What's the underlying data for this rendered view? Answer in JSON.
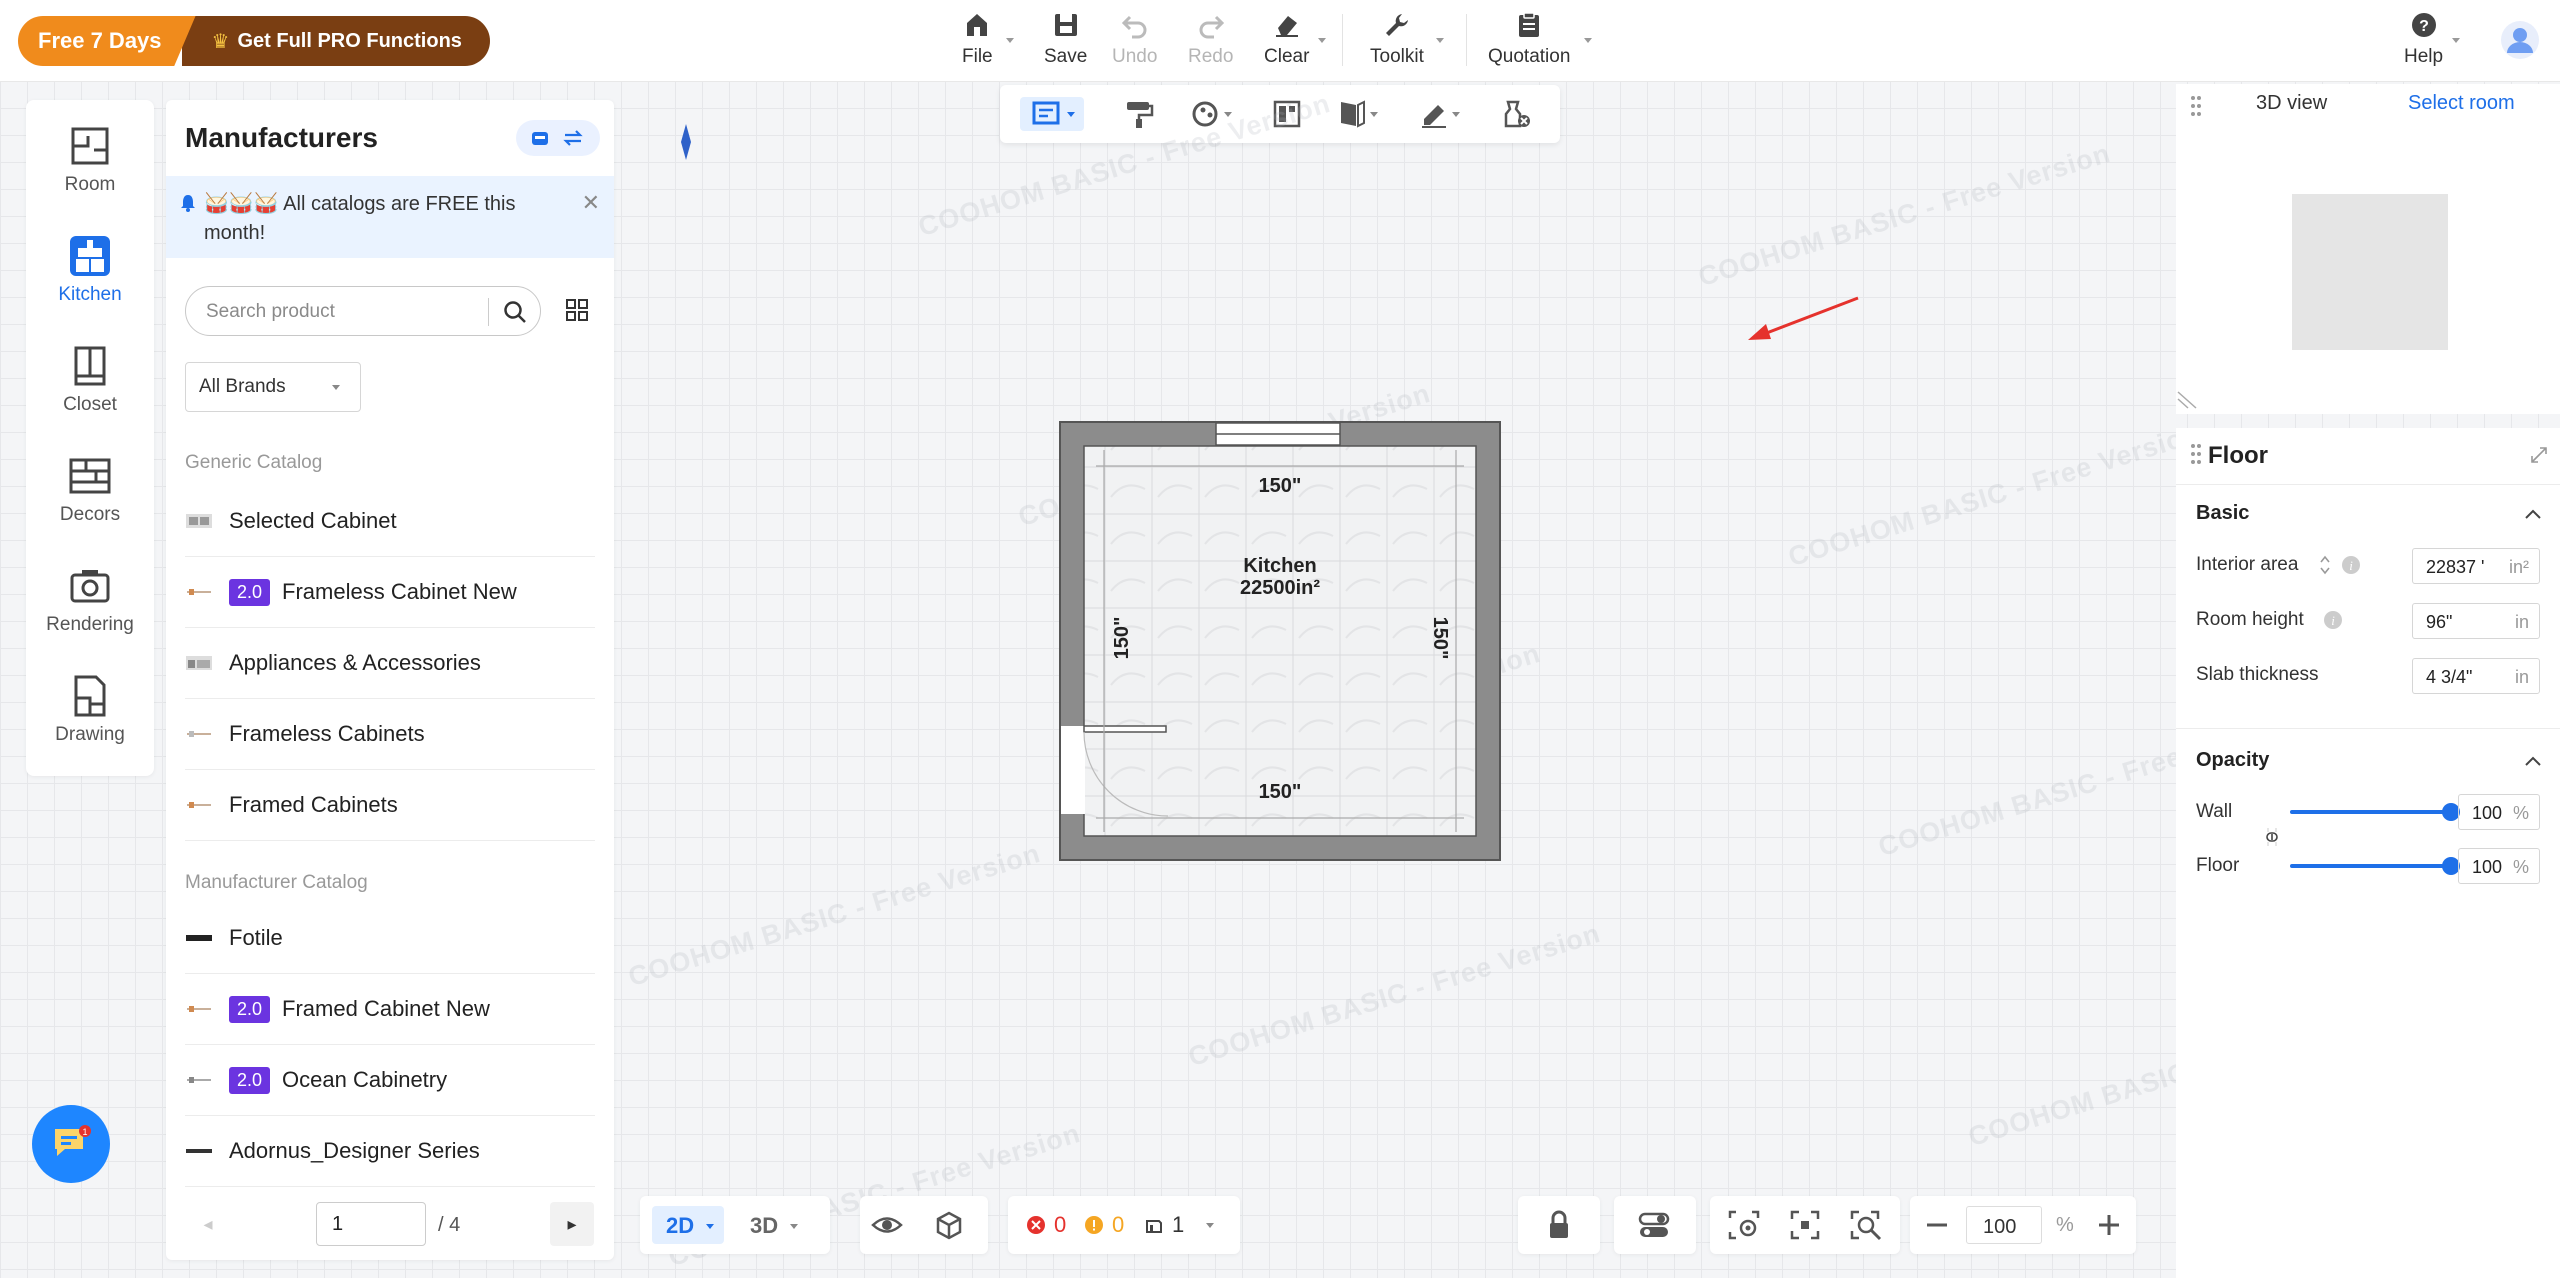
{
  "promo": {
    "free_label": "Free 7 Days",
    "pro_label": "Get Full PRO Functions"
  },
  "toolbar": {
    "file": "File",
    "save": "Save",
    "undo": "Undo",
    "redo": "Redo",
    "clear": "Clear",
    "toolkit": "Toolkit",
    "quotation": "Quotation",
    "help": "Help"
  },
  "leftnav": {
    "items": [
      {
        "label": "Room"
      },
      {
        "label": "Kitchen"
      },
      {
        "label": "Closet"
      },
      {
        "label": "Decors"
      },
      {
        "label": "Rendering"
      },
      {
        "label": "Drawing"
      }
    ]
  },
  "catalog": {
    "title": "Manufacturers",
    "notice": "🥁🥁🥁 All catalogs are FREE this month!",
    "search_placeholder": "Search product",
    "brand_filter": "All Brands",
    "generic_label": "Generic Catalog",
    "generic_items": [
      {
        "label": "Selected Cabinet",
        "badge": ""
      },
      {
        "label": "Frameless Cabinet New",
        "badge": "2.0"
      },
      {
        "label": "Appliances & Accessories",
        "badge": ""
      },
      {
        "label": "Frameless Cabinets",
        "badge": ""
      },
      {
        "label": "Framed Cabinets",
        "badge": ""
      }
    ],
    "manufacturer_label": "Manufacturer Catalog",
    "manufacturer_items": [
      {
        "label": "Fotile",
        "badge": ""
      },
      {
        "label": "Framed Cabinet New",
        "badge": "2.0"
      },
      {
        "label": "Ocean Cabinetry",
        "badge": "2.0"
      },
      {
        "label": "Adornus_Designer Series",
        "badge": ""
      }
    ],
    "page_current": "1",
    "page_total": "/ 4"
  },
  "canvas": {
    "room_name": "Kitchen",
    "room_area": "22500in²",
    "dim_top": "150\"",
    "dim_bottom": "150\"",
    "dim_left": "150\"",
    "dim_right": "150\"",
    "watermark": "COOHOM BASIC - Free Version"
  },
  "right_panel": {
    "tab_3d": "3D view",
    "tab_select_room": "Select room",
    "title": "Floor",
    "basic_label": "Basic",
    "interior_area_label": "Interior area",
    "interior_area_value": "22837 '",
    "interior_area_unit": "in²",
    "room_height_label": "Room height",
    "room_height_value": "96\"",
    "room_height_unit": "in",
    "slab_label": "Slab thickness",
    "slab_value": "4 3/4\"",
    "slab_unit": "in",
    "opacity_label": "Opacity",
    "wall_label": "Wall",
    "wall_value": "100",
    "floor_label": "Floor",
    "floor_value": "100",
    "percent": "%"
  },
  "bottom": {
    "view_2d": "2D",
    "view_3d": "3D",
    "errors": "0",
    "warnings": "0",
    "levels": "1",
    "zoom": "100",
    "zoom_unit": "%"
  },
  "colors": {
    "accent": "#1e6fe8",
    "promo_orange": "#f08b1c",
    "promo_brown": "#7a3e12",
    "badge_purple": "#6b34e0"
  }
}
